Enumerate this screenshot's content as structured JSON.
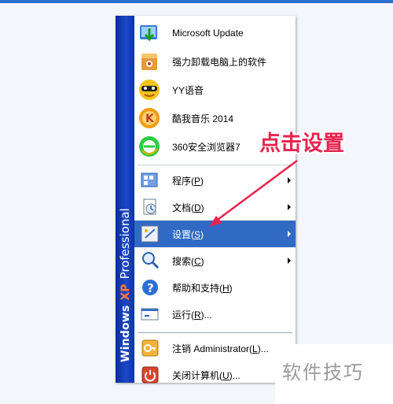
{
  "start_menu": {
    "strip": {
      "brand": "Windows",
      "xp": "XP",
      "edition": "Professional"
    },
    "pinned": [
      {
        "label": "Microsoft Update",
        "icon": "microsoft-update-icon"
      },
      {
        "label": "强力卸载电脑上的软件",
        "icon": "uninstall-icon"
      },
      {
        "label": "YY语音",
        "icon": "yy-voice-icon"
      },
      {
        "label": "酷我音乐 2014",
        "icon": "kuwo-music-icon"
      },
      {
        "label": "360安全浏览器7",
        "icon": "browser-360-icon"
      }
    ],
    "items": {
      "programs": {
        "text": "程序(",
        "key": "P",
        "end": ")",
        "icon": "programs-icon"
      },
      "documents": {
        "text": "文档(",
        "key": "D",
        "end": ")",
        "icon": "documents-icon"
      },
      "settings": {
        "text": "设置(",
        "key": "S",
        "end": ")",
        "icon": "settings-icon"
      },
      "search": {
        "text": "搜索(",
        "key": "C",
        "end": ")",
        "icon": "search-icon"
      },
      "help": {
        "text": "帮助和支持(",
        "key": "H",
        "end": ")",
        "icon": "help-icon"
      },
      "run": {
        "text": "运行(",
        "key": "R",
        "end": ")...",
        "icon": "run-icon"
      },
      "logoff": {
        "text": "注销 Administrator(",
        "key": "L",
        "end": ")...",
        "icon": "logoff-icon"
      },
      "shutdown": {
        "text": "关闭计算机(",
        "key": "U",
        "end": ")...",
        "icon": "shutdown-icon"
      }
    }
  },
  "annotation": {
    "callout": "点击设置",
    "color": "#e8234f"
  },
  "watermark": "软件技巧",
  "colors": {
    "selection": "#316ac5",
    "strip": "#1d49c8",
    "topbar": "#2f6fce"
  }
}
